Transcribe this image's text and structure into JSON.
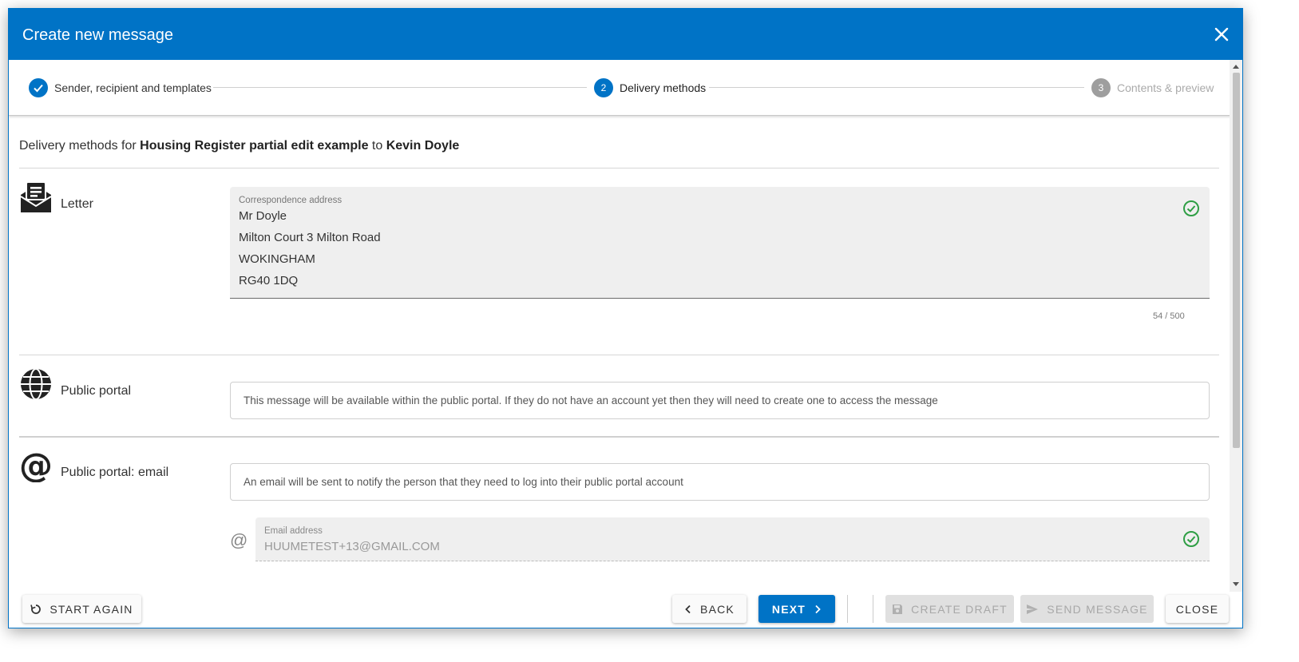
{
  "dialog": {
    "title": "Create new message"
  },
  "stepper": {
    "steps": [
      {
        "number": "1",
        "label": "Sender, recipient and templates",
        "state": "completed"
      },
      {
        "number": "2",
        "label": "Delivery methods",
        "state": "active"
      },
      {
        "number": "3",
        "label": "Contents & preview",
        "state": "inactive"
      }
    ]
  },
  "content": {
    "heading_prefix": "Delivery methods for ",
    "heading_subject": "Housing Register partial edit example",
    "heading_mid": " to ",
    "heading_recipient": "Kevin Doyle"
  },
  "letter": {
    "label": "Letter",
    "icon": "letter-icon",
    "address_label": "Correspondence address",
    "address_lines": [
      "Mr Doyle",
      "Milton Court 3 Milton Road",
      "WOKINGHAM",
      "RG40 1DQ"
    ],
    "counter": "54 / 500"
  },
  "public_portal": {
    "label": "Public portal",
    "icon": "globe-icon",
    "info": "This message will be available within the public portal. If they do not have an account yet then they will need to create one to access the message"
  },
  "portal_email": {
    "label": "Public portal: email",
    "icon": "at-icon",
    "info": "An email will be sent to notify the person that they need to log into their public portal account",
    "email_label": "Email address",
    "email_value": "HUUMETEST+13@GMAIL.COM"
  },
  "footer": {
    "start_again": "START AGAIN",
    "back": "BACK",
    "next": "NEXT",
    "create_draft": "CREATE DRAFT",
    "send_message": "SEND MESSAGE",
    "close": "CLOSE"
  },
  "colors": {
    "primary": "#0073c6",
    "success": "#2e9e44",
    "inactive": "#9e9e9e"
  }
}
